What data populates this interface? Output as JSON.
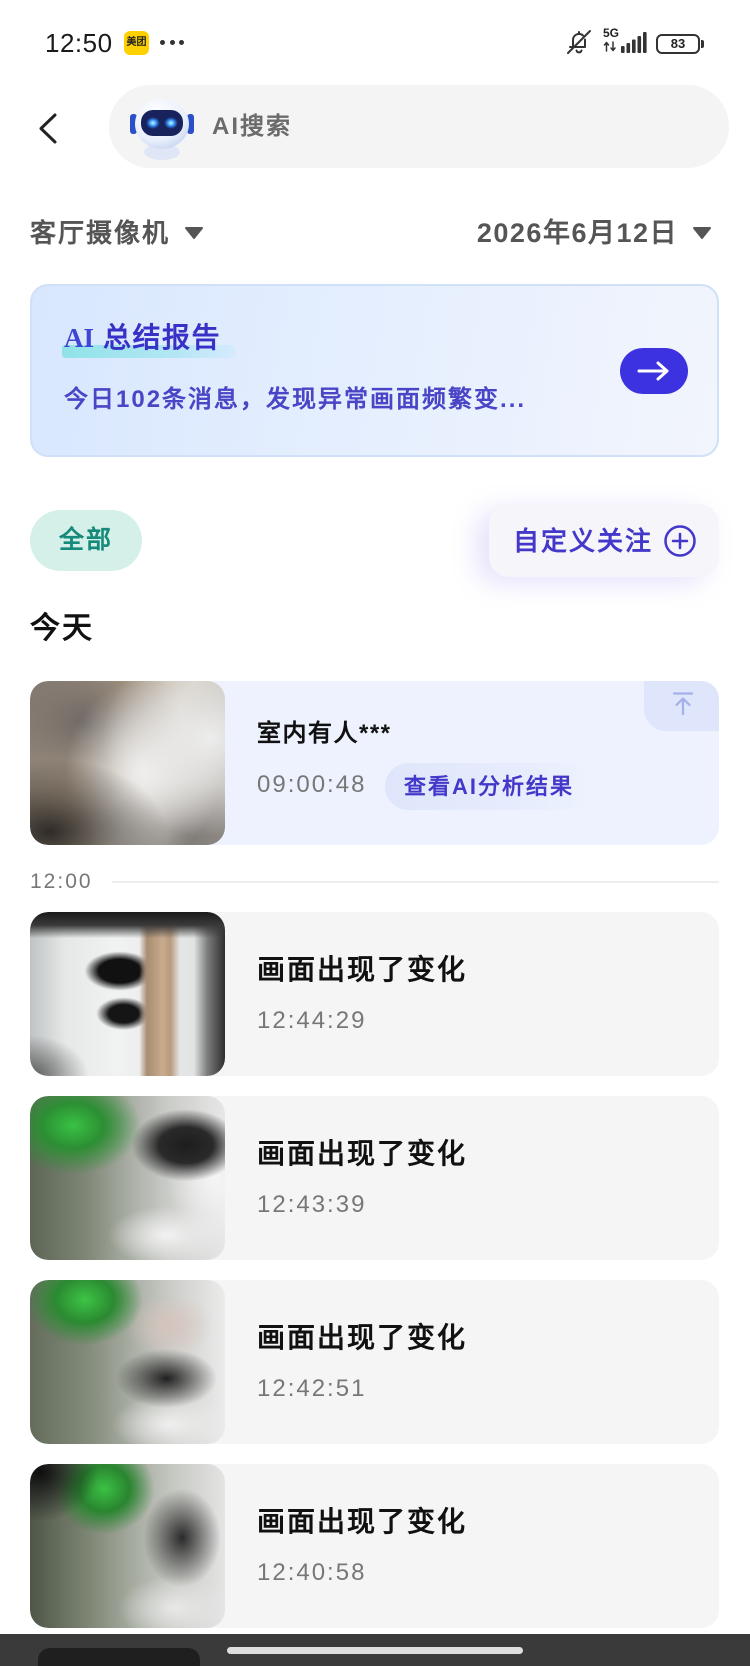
{
  "status_bar": {
    "time": "12:50",
    "meituan_badge": "美团",
    "network": "5G",
    "battery": "83",
    "icons": [
      "meituan-app-icon",
      "more-notifications-icon",
      "bell-off-icon",
      "signal-bars-icon",
      "battery-icon"
    ]
  },
  "header": {
    "back_icon": "chevron-left-icon",
    "search": {
      "label": "AI搜索",
      "avatar_icon": "ai-robot-avatar"
    }
  },
  "filters": {
    "camera": "客厅摄像机",
    "date": "2026年6月12日",
    "dropdown_icon": "caret-down-icon"
  },
  "ai_report": {
    "prefix": "AI",
    "title": "总结报告",
    "summary": "今日102条消息，发现异常画面频繁变...",
    "action_icon": "arrow-right-icon"
  },
  "chips": {
    "all": "全部",
    "custom_follow": "自定义关注",
    "custom_follow_icon": "plus-circle-icon"
  },
  "section_title": "今天",
  "pinned_event": {
    "title": "室内有人***",
    "time": "09:00:48",
    "action_label": "查看AI分析结果",
    "pin_icon": "pin-to-top-icon"
  },
  "time_divider": "12:00",
  "events": [
    {
      "title": "画面出现了变化",
      "time": "12:44:29"
    },
    {
      "title": "画面出现了变化",
      "time": "12:43:39"
    },
    {
      "title": "画面出现了变化",
      "time": "12:42:51"
    },
    {
      "title": "画面出现了变化",
      "time": "12:40:58"
    }
  ],
  "theme": {
    "accent": "#3d32e0",
    "accent_text": "#4338c9",
    "teal": "#15897a",
    "teal_bg": "#d5efe9",
    "card_bg": "#f5f5f5",
    "pinned_bg": "#edf2fe",
    "muted": "#777777"
  }
}
